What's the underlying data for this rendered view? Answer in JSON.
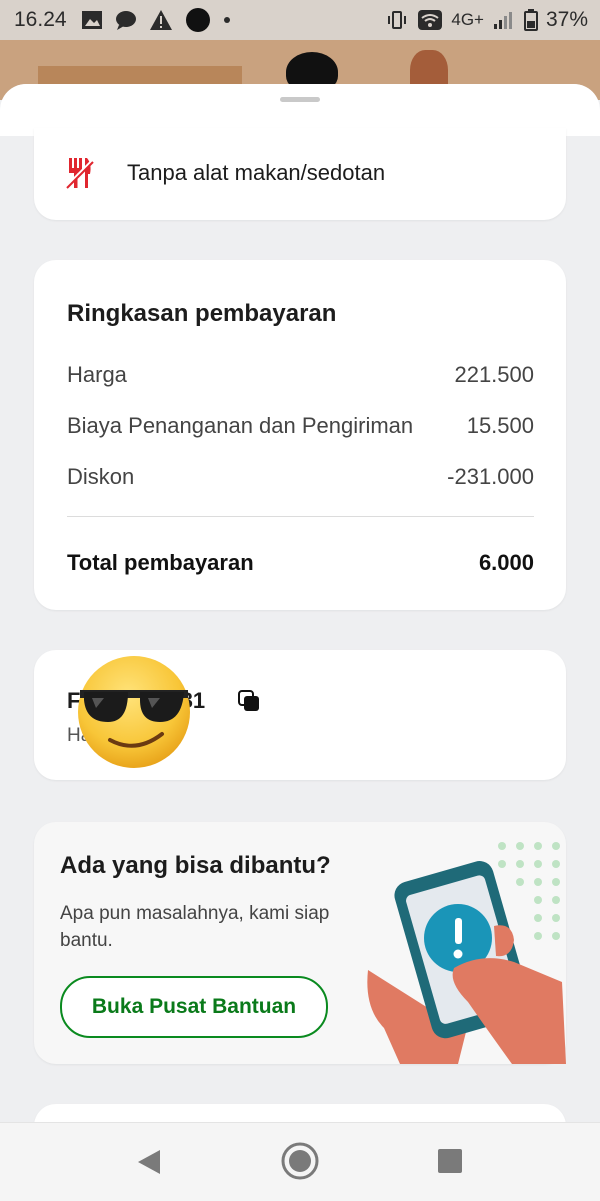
{
  "status_bar": {
    "time": "16.24",
    "network": "4G+",
    "battery": "37%"
  },
  "cutlery": {
    "label": "Tanpa alat makan/sedotan",
    "icon": "cutlery-crossed-icon"
  },
  "summary": {
    "title": "Ringkasan pembayaran",
    "rows": [
      {
        "label": "Harga",
        "value": "221.500"
      },
      {
        "label": "Biaya Penanganan dan Pengiriman",
        "value": "15.500"
      },
      {
        "label": "Diskon",
        "value": "-231.000"
      }
    ],
    "total_label": "Total pembayaran",
    "total_value": "6.000"
  },
  "order": {
    "id_visible_start": "F",
    "id_visible_end": "031",
    "sub_visible": "Ha"
  },
  "help": {
    "title": "Ada yang bisa dibantu?",
    "description": "Apa pun masalahnya, kami siap bantu.",
    "button": "Buka Pusat Bantuan"
  },
  "colors": {
    "accent_green": "#0a8a1f",
    "cutlery_red": "#e0262f",
    "sheet_bg": "#eeeff1"
  }
}
